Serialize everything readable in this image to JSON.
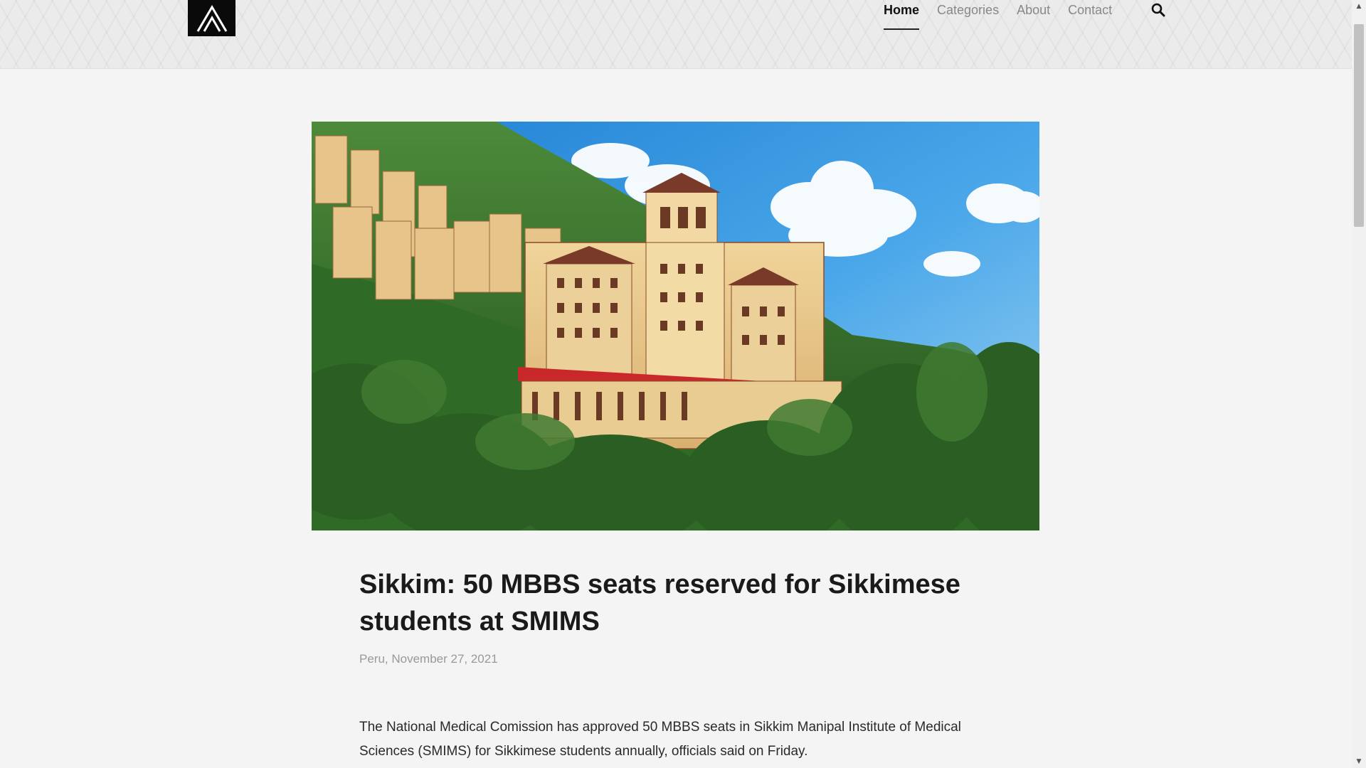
{
  "header": {
    "logo_icon": "stylized-A-logo-icon",
    "nav": {
      "home": "Home",
      "categories": "Categories",
      "about": "About",
      "contact": "Contact"
    },
    "search_icon": "search-icon",
    "active_item": "Home"
  },
  "article": {
    "image_alt": "Sikkim Manipal Institute of Medical Sciences building on a green hillside",
    "title": "Sikkim: 50 MBBS seats reserved for Sikkimese students at SMIMS",
    "meta": "Peru, November 27, 2021",
    "body": "The National Medical Comission has approved 50 MBBS seats in Sikkim Manipal Institute of Medical Sciences (SMIMS) for Sikkimese students annually, officials said on Friday."
  },
  "colors": {
    "page_bg": "#f4f4f4",
    "header_bg": "#ebebeb",
    "logo_bg": "#0a0a0a",
    "title": "#1a1a1a",
    "meta": "#999999",
    "nav_inactive": "#888888",
    "nav_active": "#111111"
  }
}
